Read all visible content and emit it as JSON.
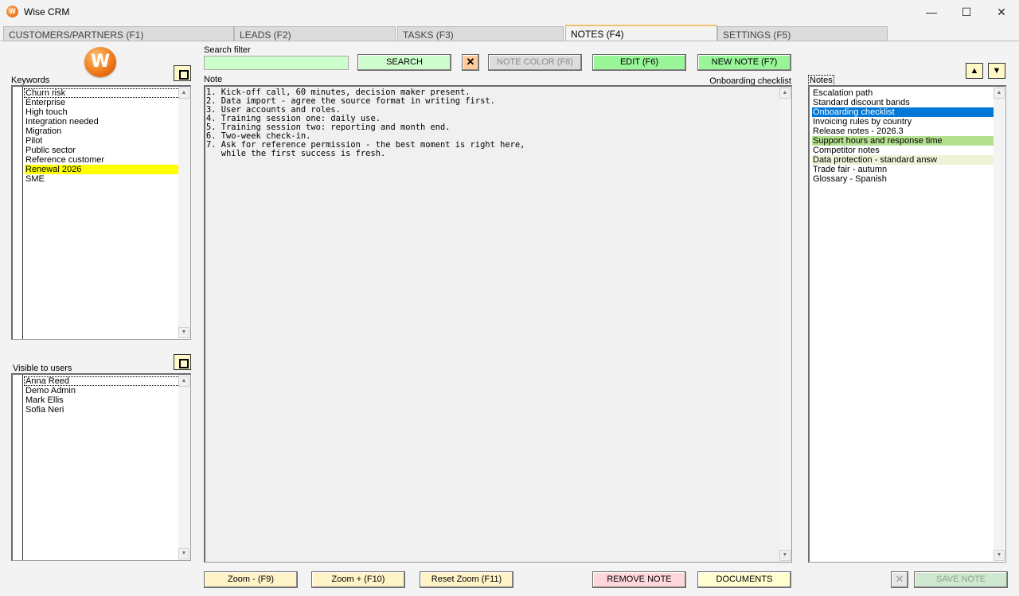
{
  "window": {
    "title": "Wise CRM"
  },
  "tabs": [
    {
      "label": "CUSTOMERS/PARTNERS (F1)"
    },
    {
      "label": "LEADS (F2)"
    },
    {
      "label": "TASKS (F3)"
    },
    {
      "label": "NOTES (F4)"
    },
    {
      "label": "SETTINGS (F5)"
    }
  ],
  "keywords": {
    "label": "Keywords",
    "items": [
      "Churn risk",
      "Enterprise",
      "High touch",
      "Integration needed",
      "Migration",
      "Pilot",
      "Public sector",
      "Reference customer",
      "Renewal 2026",
      "SME"
    ],
    "highlight_color": "#ffff00"
  },
  "visible_users": {
    "label": "Visible to users",
    "items": [
      "Anna Reed",
      "Demo Admin",
      "Mark Ellis",
      "Sofia Neri"
    ]
  },
  "search": {
    "label": "Search filter",
    "value": "",
    "search_button": "SEARCH",
    "clear_button": "✕",
    "note_color_button": "NOTE COLOR (F8)",
    "edit_button": "EDIT (F6)",
    "new_note_button": "NEW NOTE (F7)"
  },
  "note": {
    "label": "Note",
    "title": "Onboarding checklist",
    "lines": [
      "1. Kick-off call, 60 minutes, decision maker present.",
      "2. Data import - agree the source format in writing first.",
      "3. User accounts and roles.",
      "4. Training session one: daily use.",
      "5. Training session two: reporting and month end.",
      "6. Two-week check-in.",
      "7. Ask for reference permission - the best moment is right here,",
      "   while the first success is fresh."
    ]
  },
  "notes_list": {
    "label": "Notes",
    "items": [
      {
        "label": "Escalation path",
        "color": ""
      },
      {
        "label": "Standard discount bands",
        "color": ""
      },
      {
        "label": "Onboarding checklist",
        "color": "#0078d7",
        "selected": true
      },
      {
        "label": "Invoicing rules by country",
        "color": ""
      },
      {
        "label": "Release notes - 2026.3",
        "color": ""
      },
      {
        "label": "Support hours and response time",
        "color": "#b5e08f"
      },
      {
        "label": "Competitor notes",
        "color": ""
      },
      {
        "label": "Data protection - standard answ",
        "color": "#eef3d8"
      },
      {
        "label": "Trade fair - autumn",
        "color": ""
      },
      {
        "label": "Glossary - Spanish",
        "color": ""
      }
    ],
    "up_icon": "▲",
    "down_icon": "▼"
  },
  "bottom": {
    "zoom_out": "Zoom - (F9)",
    "zoom_in": "Zoom + (F10)",
    "reset_zoom": "Reset Zoom (F11)",
    "remove_note": "REMOVE NOTE",
    "documents": "DOCUMENTS",
    "cancel": "✕",
    "save_note": "SAVE NOTE"
  },
  "colors": {
    "accent_green": "#98f598",
    "selection_blue": "#0078d7",
    "search_field": "#ccffcc"
  }
}
